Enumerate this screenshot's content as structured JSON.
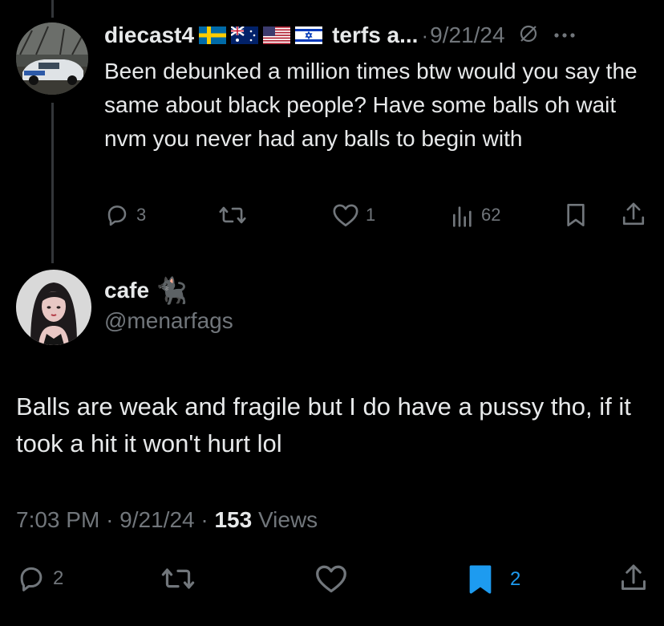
{
  "reply_parent": {
    "display_name": "diecast4",
    "flags": [
      "flag-sweden",
      "flag-uk-australia",
      "flag-usa",
      "flag-israel"
    ],
    "handle_truncated": "terfs a...",
    "separator": "·",
    "date": "9/21/24",
    "text": "Been debunked a million times btw would you say the same about black people? Have some balls oh wait nvm you never had any balls to begin with",
    "actions": {
      "replies": "3",
      "reposts": "",
      "likes": "1",
      "views": "62"
    }
  },
  "main_tweet": {
    "display_name": "cafe",
    "name_emoji": "🐈‍⬛",
    "handle": "@menarfags",
    "text": "Balls are weak and fragile but I do have a pussy tho, if it took a hit it won't hurt lol",
    "meta": {
      "time": "7:03 PM",
      "sep1": "·",
      "date": "9/21/24",
      "sep2": "·",
      "views_count": "153",
      "views_label": "Views"
    },
    "actions": {
      "replies": "2",
      "reposts": "",
      "likes": "",
      "bookmarks": "2"
    }
  },
  "colors": {
    "text": "#e7e9ea",
    "muted": "#71767b",
    "accent": "#1d9bf0",
    "background": "#000000",
    "thread_line": "#333639"
  }
}
